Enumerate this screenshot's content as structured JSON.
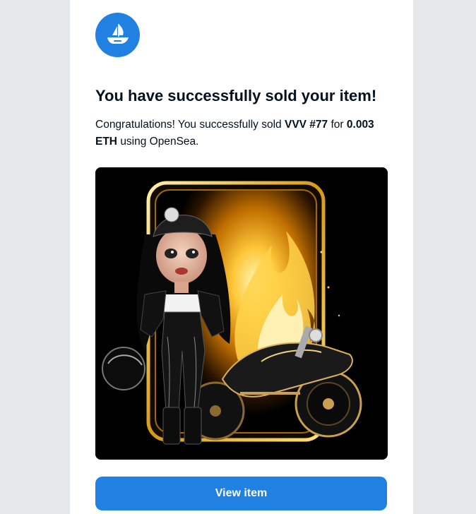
{
  "brand": {
    "logo_icon": "opensea-ship-icon",
    "color": "#2081e2"
  },
  "email": {
    "title": "You have successfully sold your item!",
    "message": {
      "intro": "Congratulations! You successfully sold",
      "item_name": "VVV #77",
      "for_text": "for",
      "price": "0.003 ETH",
      "suffix": "using OpenSea."
    },
    "nft_image": {
      "icon": "nft-artwork-image"
    },
    "cta": {
      "label": "View item",
      "color": "#2081e2"
    }
  }
}
